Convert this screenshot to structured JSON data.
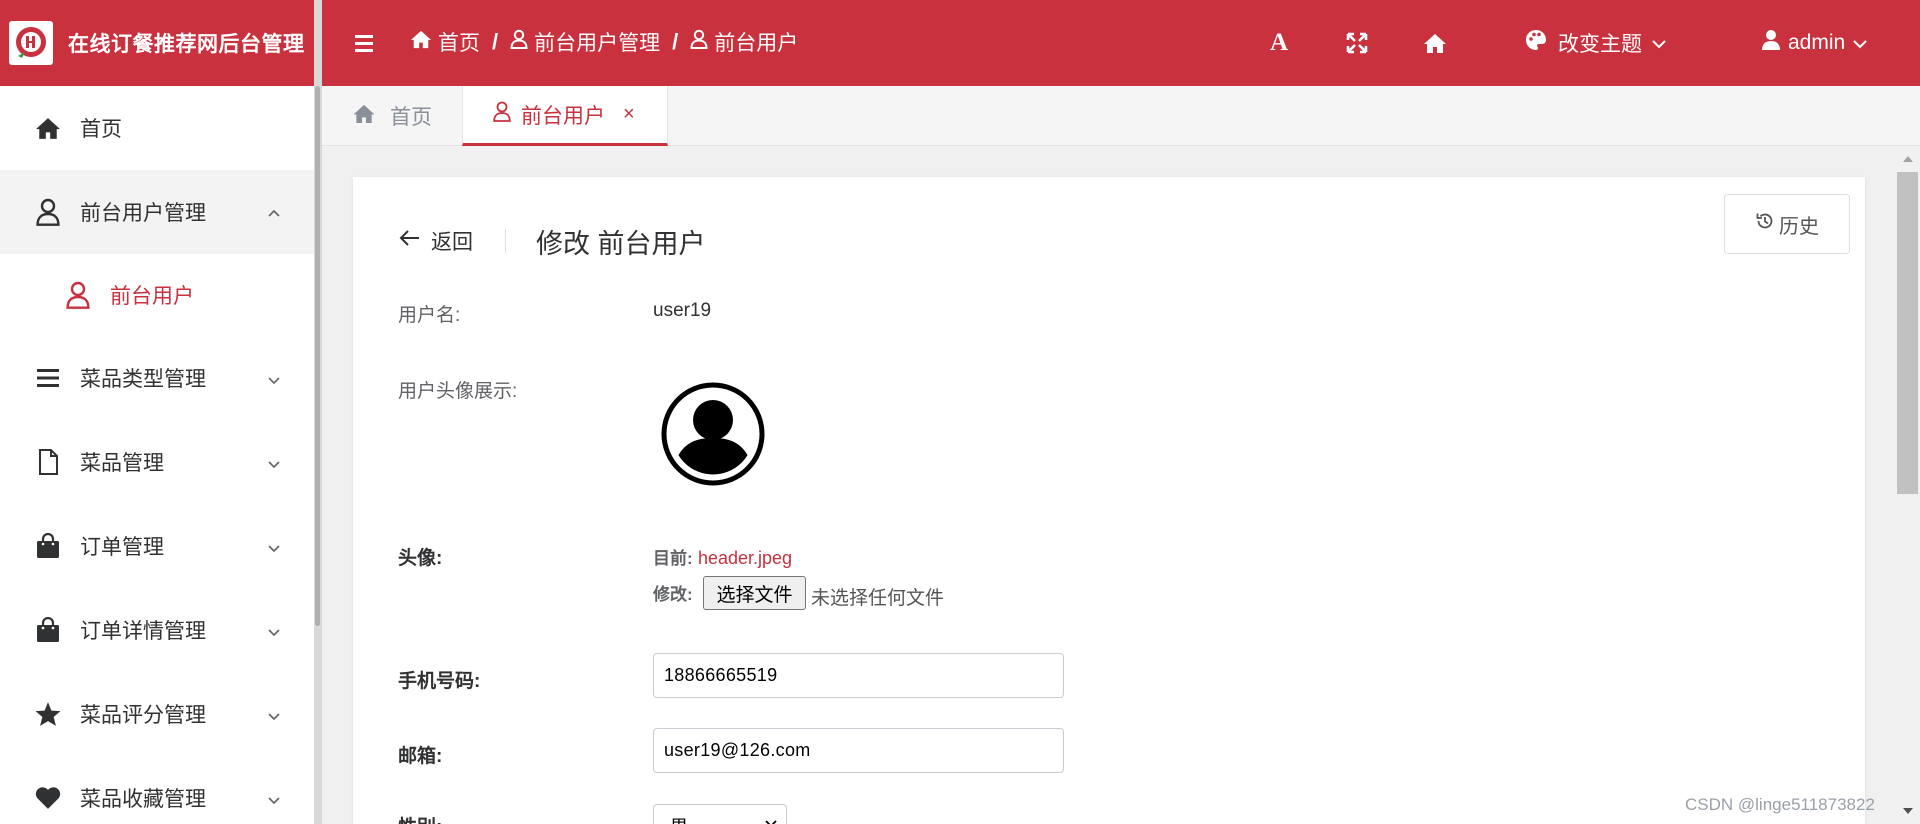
{
  "header": {
    "app_title": "在线订餐推荐网后台管理",
    "breadcrumbs": [
      "首页",
      "前台用户管理",
      "前台用户"
    ],
    "font_tool_label": "A",
    "theme_label": "改变主题",
    "user_label": "admin",
    "bg_color": "#c8313d"
  },
  "sidebar": {
    "items": [
      {
        "label": "首页",
        "icon": "home-icon"
      },
      {
        "label": "前台用户管理",
        "icon": "user-icon",
        "expanded": true,
        "children": [
          {
            "label": "前台用户",
            "icon": "user-icon",
            "active": true
          }
        ]
      },
      {
        "label": "菜品类型管理",
        "icon": "list-icon"
      },
      {
        "label": "菜品管理",
        "icon": "file-icon"
      },
      {
        "label": "订单管理",
        "icon": "bag-icon"
      },
      {
        "label": "订单详情管理",
        "icon": "bag-icon"
      },
      {
        "label": "菜品评分管理",
        "icon": "star-icon"
      },
      {
        "label": "菜品收藏管理",
        "icon": "heart-icon"
      }
    ]
  },
  "tabs": [
    {
      "label": "首页",
      "active": false
    },
    {
      "label": "前台用户",
      "active": true,
      "closable": true,
      "close_glyph": "×"
    }
  ],
  "page": {
    "history_label": "历史",
    "back_label": "返回",
    "title": "修改 前台用户",
    "fields": {
      "username_label": "用户名:",
      "username_value": "user19",
      "avatar_display_label": "用户头像展示:",
      "avatar_label": "头像:",
      "current_label": "目前:",
      "current_file": "header.jpeg",
      "modify_label": "修改:",
      "choose_file_label": "选择文件",
      "no_file_label": "未选择任何文件",
      "phone_label": "手机号码:",
      "phone_value": "18866665519",
      "email_label": "邮箱:",
      "email_value": "user19@126.com",
      "gender_label": "性别:",
      "gender_value": "男"
    }
  },
  "watermark": "CSDN @linge511873822",
  "accent_color": "#c8313d"
}
